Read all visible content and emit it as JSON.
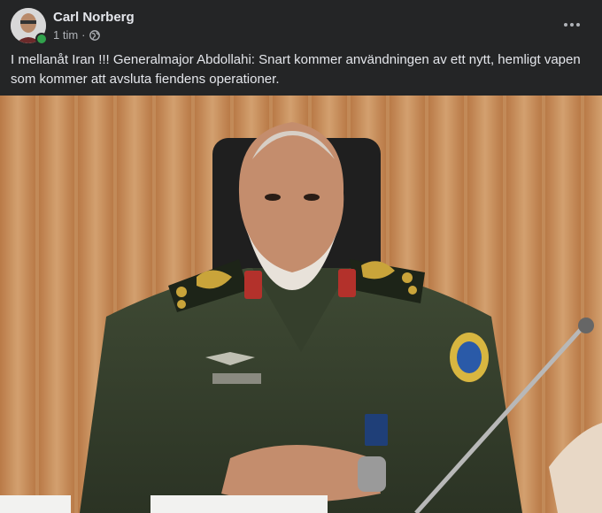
{
  "post": {
    "author": "Carl Norberg",
    "timestamp": "1 tim",
    "separator": "·",
    "privacy_icon": "globe-icon",
    "more_icon": "more-options-icon",
    "text": "I mellanåt Iran !!! Generalmajor Abdollahi: Snart kommer användningen av ett nytt, hemligt vapen som kommer att avsluta fiendens operationer.",
    "online": true
  },
  "photo": {
    "subject": "military-officer-photo",
    "nameplate": "... ..."
  },
  "colors": {
    "background": "#242526",
    "text_primary": "#e4e6eb",
    "text_secondary": "#b0b3b8",
    "online": "#31a24c"
  }
}
